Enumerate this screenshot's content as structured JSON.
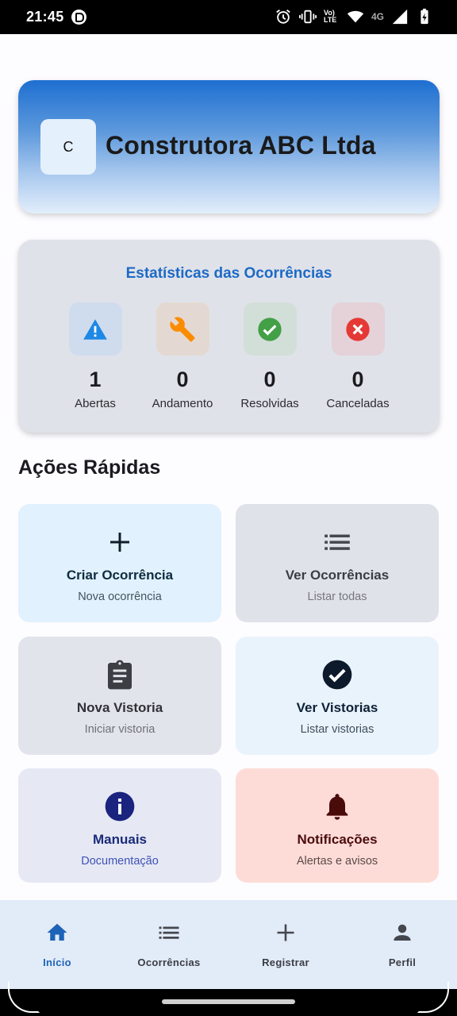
{
  "status_bar": {
    "time": "21:45",
    "volte": "Vo) LTE",
    "network": "4G",
    "icons": [
      "app-notification-icon",
      "alarm-icon",
      "vibrate-icon",
      "volte-icon",
      "wifi-icon",
      "signal-icon",
      "battery-charging-icon"
    ]
  },
  "company": {
    "initial": "C",
    "name": "Construtora ABC Ltda"
  },
  "stats": {
    "title": "Estatísticas das Ocorrências",
    "items": [
      {
        "icon": "warning-icon",
        "value": "1",
        "label": "Abertas",
        "color": "#1e88e5",
        "bg": "#cfdcee"
      },
      {
        "icon": "wrench-icon",
        "value": "0",
        "label": "Andamento",
        "color": "#fb8c00",
        "bg": "#e4d9d2"
      },
      {
        "icon": "check-circle-icon",
        "value": "0",
        "label": "Resolvidas",
        "color": "#43a047",
        "bg": "#d2dfd8"
      },
      {
        "icon": "cancel-circle-icon",
        "value": "0",
        "label": "Canceladas",
        "color": "#e53935",
        "bg": "#e4d2d8"
      }
    ]
  },
  "quick_actions": {
    "title": "Ações Rápidas",
    "items": [
      {
        "icon": "plus-icon",
        "title": "Criar Ocorrência",
        "subtitle": "Nova ocorrência",
        "bg": "#e1f1fd",
        "title_color": "#0e2b3e",
        "sub_color": "#43535f"
      },
      {
        "icon": "list-icon",
        "title": "Ver Ocorrências",
        "subtitle": "Listar todas",
        "bg": "#e0e2e9",
        "title_color": "#3b3d44",
        "sub_color": "#75777e"
      },
      {
        "icon": "clipboard-icon",
        "title": "Nova Vistoria",
        "subtitle": "Iniciar vistoria",
        "bg": "#e2e4eb",
        "title_color": "#2f3136",
        "sub_color": "#6f7178"
      },
      {
        "icon": "check-circle-icon",
        "title": "Ver Vistorias",
        "subtitle": "Listar vistorias",
        "bg": "#e9f3fb",
        "title_color": "#0d2137",
        "sub_color": "#3f4e5c"
      },
      {
        "icon": "info-icon",
        "title": "Manuais",
        "subtitle": "Documentação",
        "bg": "#e6e9f4",
        "title_color": "#1b2a7a",
        "sub_color": "#3f51b5"
      },
      {
        "icon": "bell-icon",
        "title": "Notificações",
        "subtitle": "Alertas e avisos",
        "bg": "#fddcd8",
        "title_color": "#4a0b0b",
        "sub_color": "#5b4a48"
      }
    ]
  },
  "bottom_nav": {
    "items": [
      {
        "icon": "home-icon",
        "label": "Início",
        "active": true
      },
      {
        "icon": "list-icon",
        "label": "Ocorrências",
        "active": false
      },
      {
        "icon": "plus-icon",
        "label": "Registrar",
        "active": false
      },
      {
        "icon": "person-icon",
        "label": "Perfil",
        "active": false
      }
    ]
  },
  "colors": {
    "primary": "#1d6ac6",
    "active_nav": "#1d63b8",
    "nav_bg": "#e2ebf8"
  }
}
